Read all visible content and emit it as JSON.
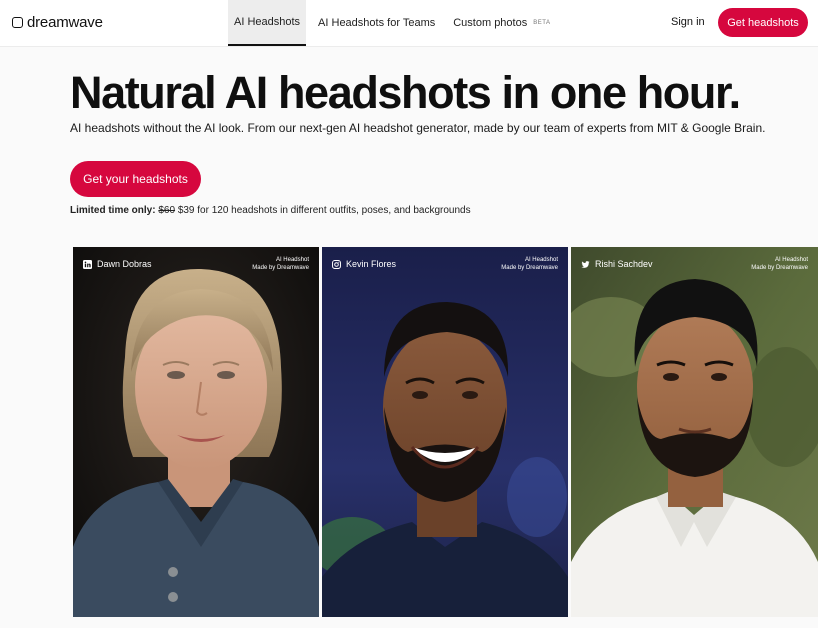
{
  "header": {
    "brand": "dreamwave",
    "nav": [
      {
        "label": "AI Headshots",
        "active": true
      },
      {
        "label": "AI Headshots for Teams"
      },
      {
        "label": "Custom photos",
        "badge": "BETA"
      }
    ],
    "sign_in": "Sign in",
    "cta": "Get headshots"
  },
  "hero": {
    "title": "Natural AI headshots in one hour.",
    "subtitle": "AI headshots without the AI look. From our next-gen AI headshot generator, made by our team of experts from MIT & Google Brain.",
    "cta": "Get your headshots",
    "offer": {
      "prefix": "Limited time only:",
      "old_price": "$60",
      "text": "$39 for 120 headshots in different outfits, poses, and backgrounds"
    }
  },
  "cards": [
    {
      "name": "Dawn Dobras",
      "social_icon": "linkedin-icon",
      "badge_line1": "AI Headshot",
      "badge_line2": "Made by Dreamwave"
    },
    {
      "name": "Kevin Flores",
      "social_icon": "instagram-icon",
      "badge_line1": "AI Headshot",
      "badge_line2": "Made by Dreamwave"
    },
    {
      "name": "Rishi Sachdev",
      "social_icon": "twitter-icon",
      "badge_line1": "AI Headshot",
      "badge_line2": "Made by Dreamwave"
    }
  ],
  "colors": {
    "accent": "#d6073e",
    "text": "#111111",
    "background": "#fafafa"
  }
}
